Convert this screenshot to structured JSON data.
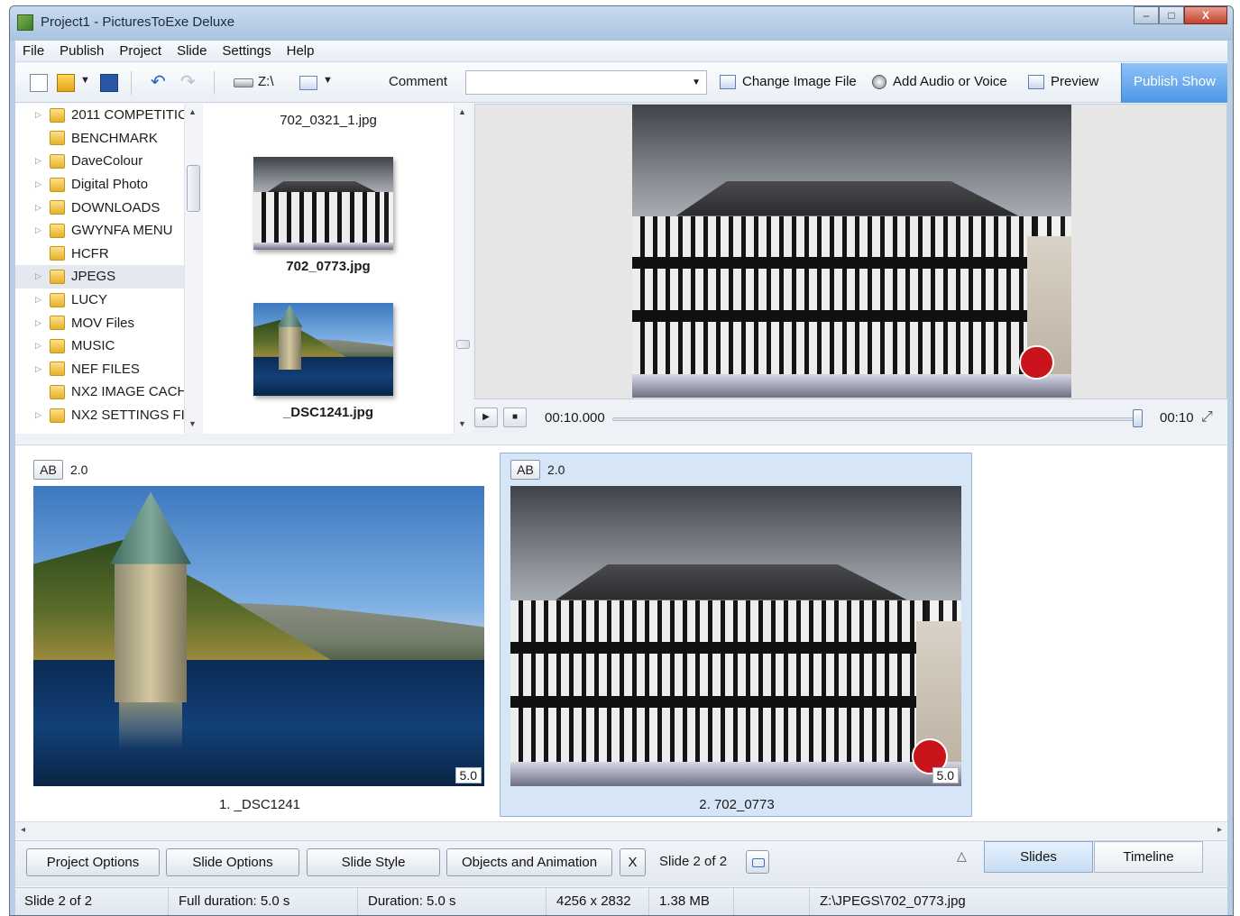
{
  "window": {
    "title": "Project1 - PicturesToExe Deluxe",
    "controls": {
      "minimize": "–",
      "maximize": "□",
      "close": "X"
    }
  },
  "menu": [
    "File",
    "Publish",
    "Project",
    "Slide",
    "Settings",
    "Help"
  ],
  "toolbar": {
    "drive_label": "Z:\\",
    "comment_label": "Comment",
    "comment_value": "",
    "change_image_label": "Change Image File",
    "add_audio_label": "Add Audio or Voice",
    "preview_label": "Preview",
    "publish_label": "Publish Show",
    "icons": [
      "new-project-icon",
      "open-project-icon",
      "save-icon",
      "undo-icon",
      "redo-icon",
      "drive-icon",
      "view-mode-icon"
    ]
  },
  "folders": [
    {
      "name": "2011 COMPETITIC",
      "expandable": true
    },
    {
      "name": "BENCHMARK",
      "expandable": false
    },
    {
      "name": "DaveColour",
      "expandable": true
    },
    {
      "name": "Digital Photo",
      "expandable": true
    },
    {
      "name": "DOWNLOADS",
      "expandable": true
    },
    {
      "name": "GWYNFA MENU",
      "expandable": true
    },
    {
      "name": "HCFR",
      "expandable": false
    },
    {
      "name": "JPEGS",
      "expandable": true,
      "selected": true
    },
    {
      "name": "LUCY",
      "expandable": true
    },
    {
      "name": "MOV Files",
      "expandable": true
    },
    {
      "name": "MUSIC",
      "expandable": true
    },
    {
      "name": "NEF FILES",
      "expandable": true
    },
    {
      "name": "NX2 IMAGE CACH",
      "expandable": false
    },
    {
      "name": "NX2 SETTINGS FIL",
      "expandable": true
    }
  ],
  "files": [
    {
      "name": "702_0321_1.jpg",
      "bold": false
    },
    {
      "name": "702_0773.jpg",
      "bold": true
    },
    {
      "name": "_DSC1241.jpg",
      "bold": true
    }
  ],
  "transport": {
    "current_time": "00:10.000",
    "end_time": "00:10",
    "position_fraction": 1.0
  },
  "slides": [
    {
      "caption": "1. _DSC1241",
      "transition": "AB",
      "transition_duration": "2.0",
      "duration": "5.0",
      "selected": false
    },
    {
      "caption": "2. 702_0773",
      "transition": "AB",
      "transition_duration": "2.0",
      "duration": "5.0",
      "selected": true
    }
  ],
  "bottom": {
    "project_options": "Project Options",
    "slide_options": "Slide Options",
    "slide_style": "Slide Style",
    "objects_animation": "Objects and Animation",
    "close_x": "X",
    "slide_counter": "Slide 2 of 2",
    "tab_slides": "Slides",
    "tab_timeline": "Timeline",
    "active_tab": "Slides"
  },
  "status": {
    "slide": "Slide 2 of 2",
    "full_duration": "Full duration: 5.0 s",
    "duration": "Duration: 5.0 s",
    "resolution": "4256 x 2832",
    "filesize": "1.38 MB",
    "path": "Z:\\JPEGS\\702_0773.jpg"
  },
  "colors": {
    "accent": "#4d97e6",
    "selection": "#d7e6f7",
    "titlebar": "#b9cde3"
  }
}
